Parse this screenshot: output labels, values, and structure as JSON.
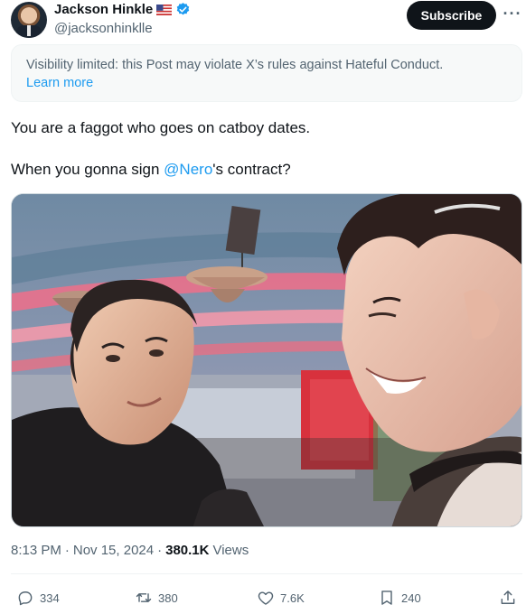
{
  "author": {
    "name": "Jackson Hinkle",
    "flag_icon": "us-flag-icon",
    "verified_icon": "verified-badge-icon",
    "handle": "@jacksonhinklle",
    "subscribe_label": "Subscribe",
    "more_label": "···"
  },
  "notice": {
    "text": "Visibility limited: this Post may violate X’s rules against Hateful Conduct.",
    "link": "Learn more"
  },
  "tweet": {
    "line1": "You are a faggot who goes on catboy dates.",
    "line2_before": "When you gonna sign ",
    "line2_mention": "@Nero",
    "line2_after": "'s contract?"
  },
  "meta": {
    "time": "8:13 PM",
    "sep1": "·",
    "date": "Nov 15, 2024",
    "sep2": "·",
    "views_count": "380.1K",
    "views_label": "Views"
  },
  "actions": {
    "replies": "334",
    "reposts": "380",
    "likes": "7.6K",
    "bookmarks": "240"
  },
  "colors": {
    "accent": "#1d9bf0",
    "text_secondary": "#536471",
    "text_primary": "#0f1419"
  }
}
